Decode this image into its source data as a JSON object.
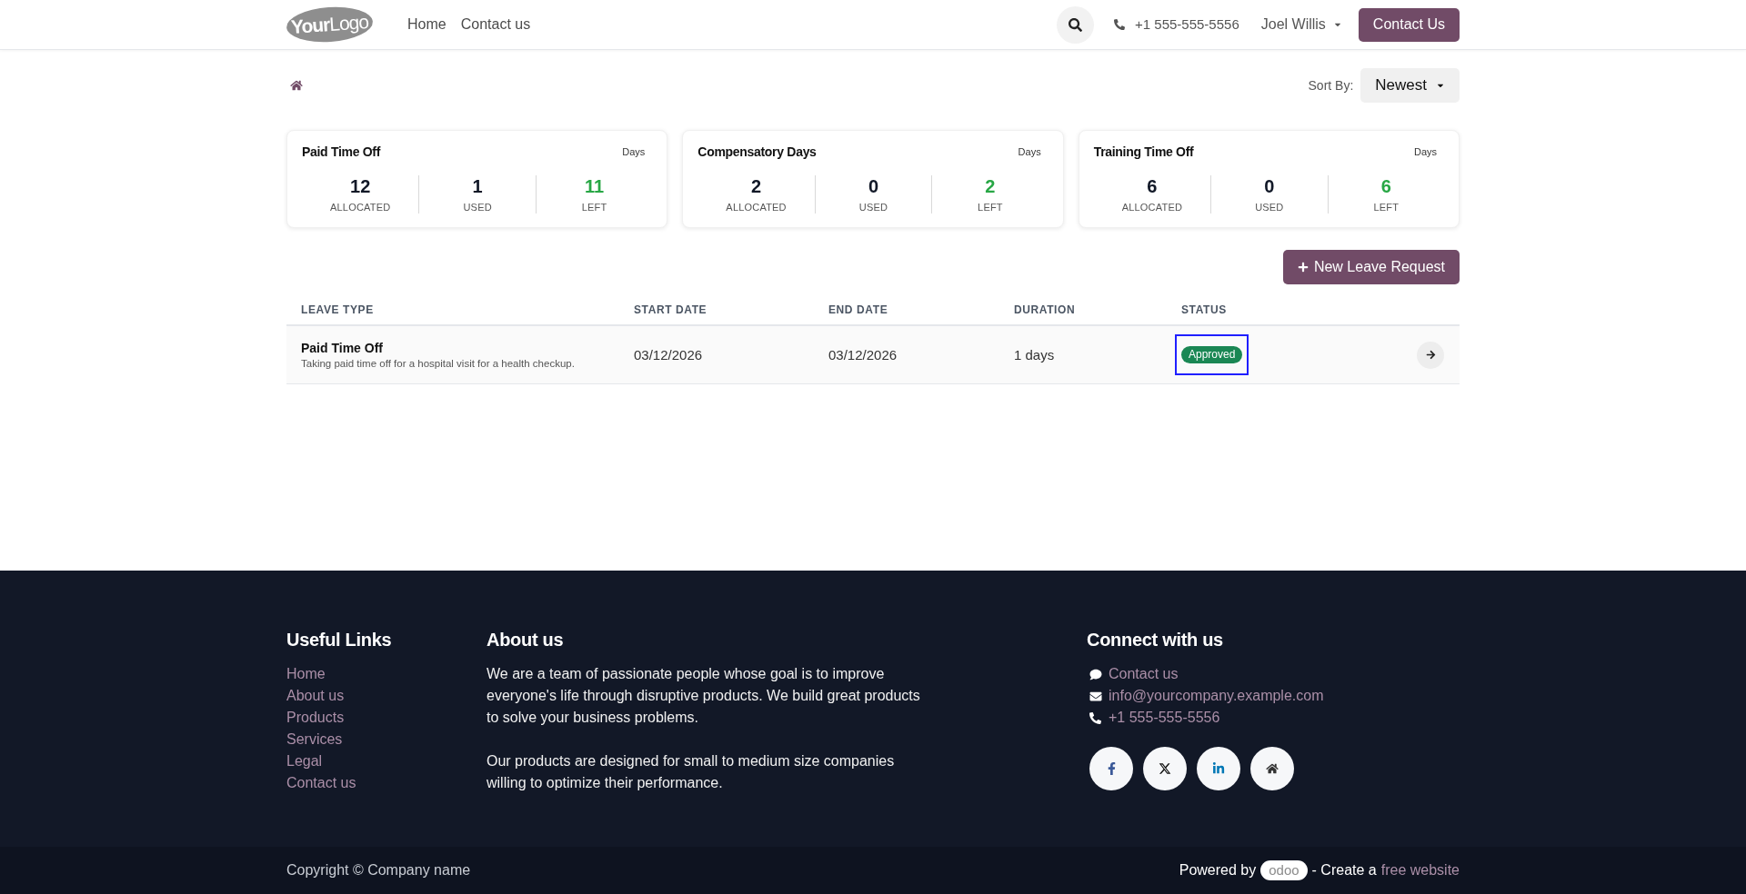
{
  "header": {
    "logo": "**Your**Logo",
    "nav": [
      {
        "label": "Home"
      },
      {
        "label": "Contact us"
      }
    ],
    "phone": "+1 555-555-5556",
    "user": "Joel Willis",
    "cta": "Contact Us"
  },
  "toolbar": {
    "sort_label": "Sort By:",
    "sort_value": "Newest"
  },
  "summary_cards": [
    {
      "title": "Paid Time Off",
      "unit": "Days",
      "stats": [
        {
          "value": "12",
          "label": "ALLOCATED",
          "kind": "plain"
        },
        {
          "value": "1",
          "label": "USED",
          "kind": "plain"
        },
        {
          "value": "11",
          "label": "LEFT",
          "kind": "remaining"
        }
      ]
    },
    {
      "title": "Compensatory Days",
      "unit": "Days",
      "stats": [
        {
          "value": "2",
          "label": "ALLOCATED",
          "kind": "plain"
        },
        {
          "value": "0",
          "label": "USED",
          "kind": "plain"
        },
        {
          "value": "2",
          "label": "LEFT",
          "kind": "remaining"
        }
      ]
    },
    {
      "title": "Training Time Off",
      "unit": "Days",
      "stats": [
        {
          "value": "6",
          "label": "ALLOCATED",
          "kind": "plain"
        },
        {
          "value": "0",
          "label": "USED",
          "kind": "plain"
        },
        {
          "value": "6",
          "label": "LEFT",
          "kind": "remaining"
        }
      ]
    }
  ],
  "new_request_button": "New Leave Request",
  "table": {
    "columns": [
      "LEAVE TYPE",
      "START DATE",
      "END DATE",
      "DURATION",
      "STATUS"
    ],
    "rows": [
      {
        "leave_type": "Paid Time Off",
        "description": "Taking paid time off for a hospital visit for a health checkup.",
        "start_date": "03/12/2026",
        "end_date": "03/12/2026",
        "duration": "1 days",
        "status": {
          "label": "Approved",
          "kind": "approved",
          "highlighted": true
        }
      }
    ]
  },
  "footer": {
    "useful_links": {
      "title": "Useful Links",
      "links": [
        "Home",
        "About us",
        "Products",
        "Services",
        "Legal",
        "Contact us"
      ]
    },
    "about": {
      "title": "About us",
      "paragraphs": [
        "We are a team of passionate people whose goal is to improve everyone's life through disruptive products. We build great products to solve your business problems.",
        "Our products are designed for small to medium size companies willing to optimize their performance."
      ]
    },
    "connect": {
      "title": "Connect with us",
      "items": [
        {
          "kind": "chat",
          "label": "Contact us"
        },
        {
          "kind": "email",
          "label": "info@yourcompany.example.com"
        },
        {
          "kind": "phone",
          "label": "+1 555-555-5556"
        }
      ]
    }
  },
  "bottom_bar": {
    "copyright": "Copyright © Company name",
    "powered_by": "Powered by",
    "brand": "odoo",
    "middle": "- Create a",
    "link": "free website"
  }
}
